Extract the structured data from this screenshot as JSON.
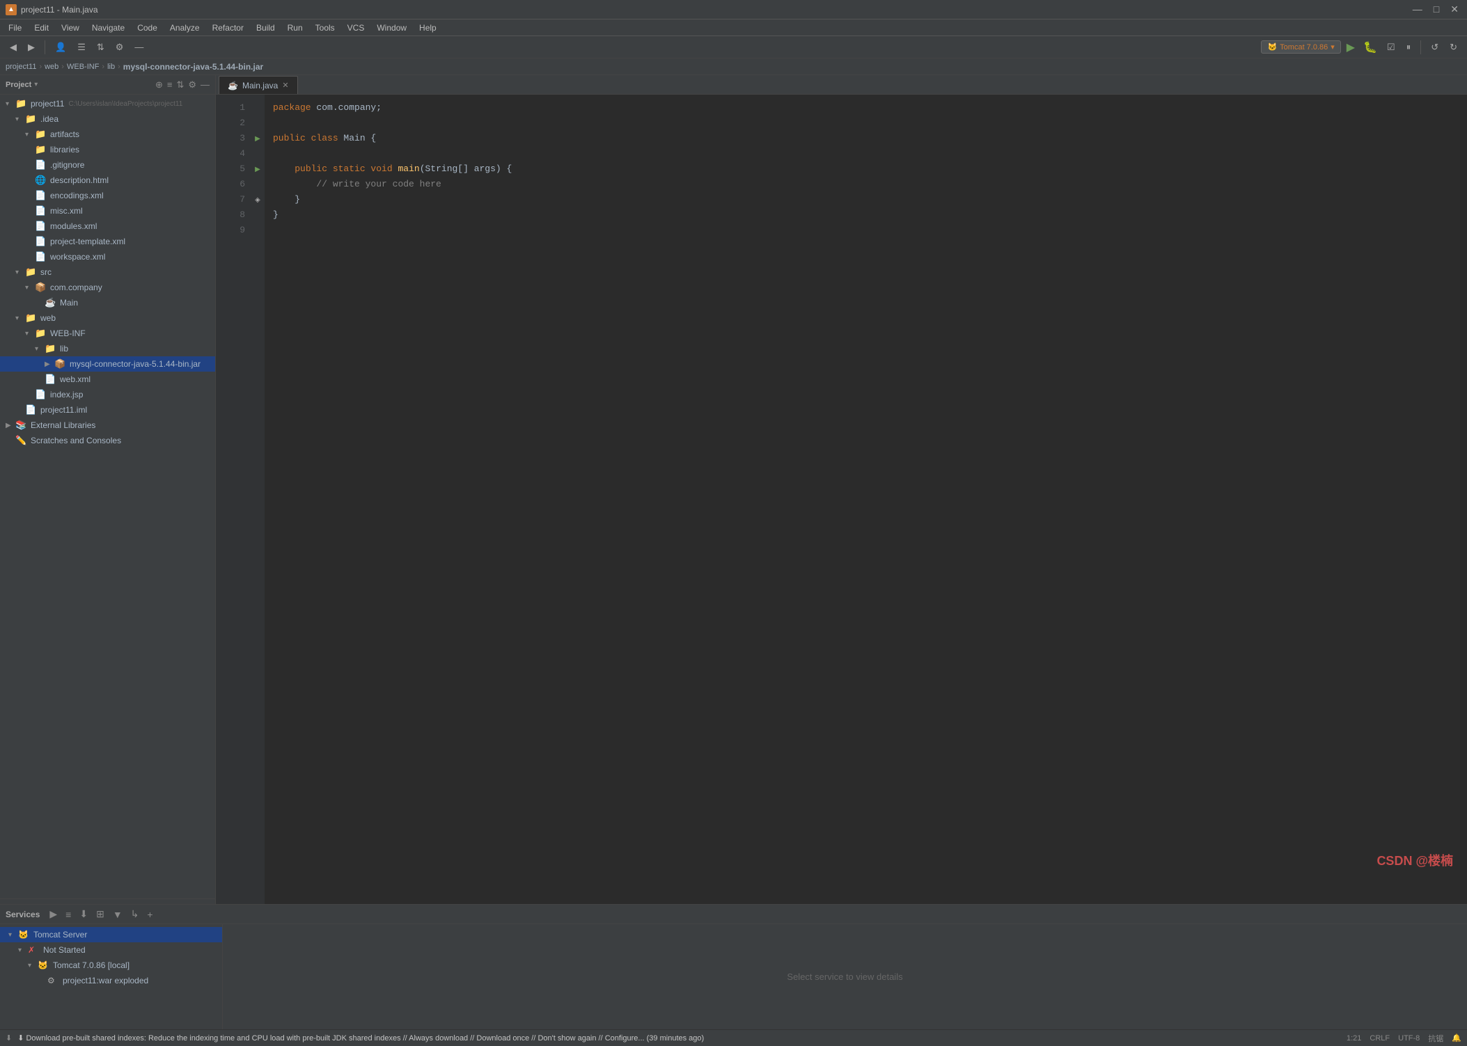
{
  "window": {
    "title": "project11 - Main.java",
    "os_icon": "▲"
  },
  "menu": {
    "items": [
      "File",
      "Edit",
      "View",
      "Navigate",
      "Code",
      "Analyze",
      "Refactor",
      "Build",
      "Run",
      "Tools",
      "VCS",
      "Window",
      "Help"
    ]
  },
  "breadcrumb": {
    "items": [
      "project11",
      "web",
      "WEB-INF",
      "lib",
      "mysql-connector-java-5.1.44-bin.jar"
    ]
  },
  "toolbar": {
    "run_config": "Tomcat 7.0.86",
    "run_config_icon": "🐱"
  },
  "sidebar": {
    "title": "Project",
    "tree": [
      {
        "level": 0,
        "arrow": "▾",
        "icon": "📁",
        "icon_class": "icon-folder",
        "label": "project11",
        "extra": "C:\\Users\\islan\\IdeaProjects\\project11",
        "selected": false
      },
      {
        "level": 1,
        "arrow": "▾",
        "icon": "📁",
        "icon_class": "icon-folder",
        "label": ".idea",
        "extra": "",
        "selected": false
      },
      {
        "level": 2,
        "arrow": "▾",
        "icon": "📁",
        "icon_class": "icon-folder",
        "label": "artifacts",
        "extra": "",
        "selected": false
      },
      {
        "level": 2,
        "arrow": " ",
        "icon": "📁",
        "icon_class": "icon-folder",
        "label": "libraries",
        "extra": "",
        "selected": false
      },
      {
        "level": 2,
        "arrow": " ",
        "icon": "📄",
        "icon_class": "icon-gitignore",
        "label": ".gitignore",
        "extra": "",
        "selected": false
      },
      {
        "level": 2,
        "arrow": " ",
        "icon": "📄",
        "icon_class": "icon-xml",
        "label": "description.html",
        "extra": "",
        "selected": false
      },
      {
        "level": 2,
        "arrow": " ",
        "icon": "📄",
        "icon_class": "icon-xml",
        "label": "encodings.xml",
        "extra": "",
        "selected": false
      },
      {
        "level": 2,
        "arrow": " ",
        "icon": "📄",
        "icon_class": "icon-xml",
        "label": "misc.xml",
        "extra": "",
        "selected": false
      },
      {
        "level": 2,
        "arrow": " ",
        "icon": "📄",
        "icon_class": "icon-xml",
        "label": "modules.xml",
        "extra": "",
        "selected": false
      },
      {
        "level": 2,
        "arrow": " ",
        "icon": "📄",
        "icon_class": "icon-xml",
        "label": "project-template.xml",
        "extra": "",
        "selected": false
      },
      {
        "level": 2,
        "arrow": " ",
        "icon": "📄",
        "icon_class": "icon-xml",
        "label": "workspace.xml",
        "extra": "",
        "selected": false
      },
      {
        "level": 1,
        "arrow": "▾",
        "icon": "📁",
        "icon_class": "icon-folder",
        "label": "src",
        "extra": "",
        "selected": false
      },
      {
        "level": 2,
        "arrow": "▾",
        "icon": "📦",
        "icon_class": "icon-folder",
        "label": "com.company",
        "extra": "",
        "selected": false
      },
      {
        "level": 3,
        "arrow": " ",
        "icon": "☕",
        "icon_class": "icon-java",
        "label": "Main",
        "extra": "",
        "selected": false
      },
      {
        "level": 1,
        "arrow": "▾",
        "icon": "📁",
        "icon_class": "icon-folder",
        "label": "web",
        "extra": "",
        "selected": false
      },
      {
        "level": 2,
        "arrow": "▾",
        "icon": "📁",
        "icon_class": "icon-folder",
        "label": "WEB-INF",
        "extra": "",
        "selected": false
      },
      {
        "level": 3,
        "arrow": "▾",
        "icon": "📁",
        "icon_class": "icon-folder",
        "label": "lib",
        "extra": "",
        "selected": false
      },
      {
        "level": 4,
        "arrow": "▶",
        "icon": "📦",
        "icon_class": "icon-jar",
        "label": "mysql-connector-java-5.1.44-bin.jar",
        "extra": "",
        "selected": true
      },
      {
        "level": 3,
        "arrow": " ",
        "icon": "📄",
        "icon_class": "icon-xml",
        "label": "web.xml",
        "extra": "",
        "selected": false
      },
      {
        "level": 2,
        "arrow": " ",
        "icon": "📄",
        "icon_class": "icon-jsp",
        "label": "index.jsp",
        "extra": "",
        "selected": false
      },
      {
        "level": 1,
        "arrow": " ",
        "icon": "📄",
        "icon_class": "icon-iml",
        "label": "project11.iml",
        "extra": "",
        "selected": false
      },
      {
        "level": 0,
        "arrow": "▶",
        "icon": "📚",
        "icon_class": "external-lib-icon",
        "label": "External Libraries",
        "extra": "",
        "selected": false
      },
      {
        "level": 0,
        "arrow": " ",
        "icon": "✏️",
        "icon_class": "icon-scratches",
        "label": "Scratches and Consoles",
        "extra": "",
        "selected": false
      }
    ]
  },
  "editor": {
    "tab_label": "Main.java",
    "lines": [
      {
        "num": 1,
        "code": "<span class='kw'>package</span> com.company;"
      },
      {
        "num": 2,
        "code": ""
      },
      {
        "num": 3,
        "code": "<span class='kw'>public class</span> <span class='cls'>Main</span> {"
      },
      {
        "num": 4,
        "code": ""
      },
      {
        "num": 5,
        "code": "    <span class='kw'>public static void</span> <span class='meth'>main</span>(<span class='cls'>String</span>[] args) {"
      },
      {
        "num": 6,
        "code": "        <span class='comment'>// write your code here</span>"
      },
      {
        "num": 7,
        "code": "    }"
      },
      {
        "num": 8,
        "code": "}"
      },
      {
        "num": 9,
        "code": ""
      }
    ]
  },
  "services": {
    "title": "Services",
    "toolbar_buttons": [
      "▶",
      "≡",
      "⬇",
      "⊞",
      "▼",
      "↳",
      "+"
    ],
    "tree": [
      {
        "level": 0,
        "arrow": "▾",
        "icon": "🐱",
        "label": "Tomcat Server",
        "selected": true
      },
      {
        "level": 1,
        "arrow": "▾",
        "icon": "✗",
        "label": "Not Started",
        "selected": false
      },
      {
        "level": 2,
        "arrow": "▾",
        "icon": "🐱",
        "label": "Tomcat 7.0.86 [local]",
        "selected": false
      },
      {
        "level": 3,
        "arrow": " ",
        "icon": "⚙",
        "label": "project11:war exploded",
        "selected": false
      }
    ],
    "detail_placeholder": "Select service to view details"
  },
  "status_bar": {
    "message": "⬇ Download pre-built shared indexes: Reduce the indexing time and CPU load with pre-built JDK shared indexes // Always download // Download once // Don't show again // Configure... (39 minutes ago)",
    "position": "1:21",
    "line_ending": "CRLF",
    "encoding": "UTF-8",
    "indent": "抗锯",
    "icon": "↙"
  }
}
